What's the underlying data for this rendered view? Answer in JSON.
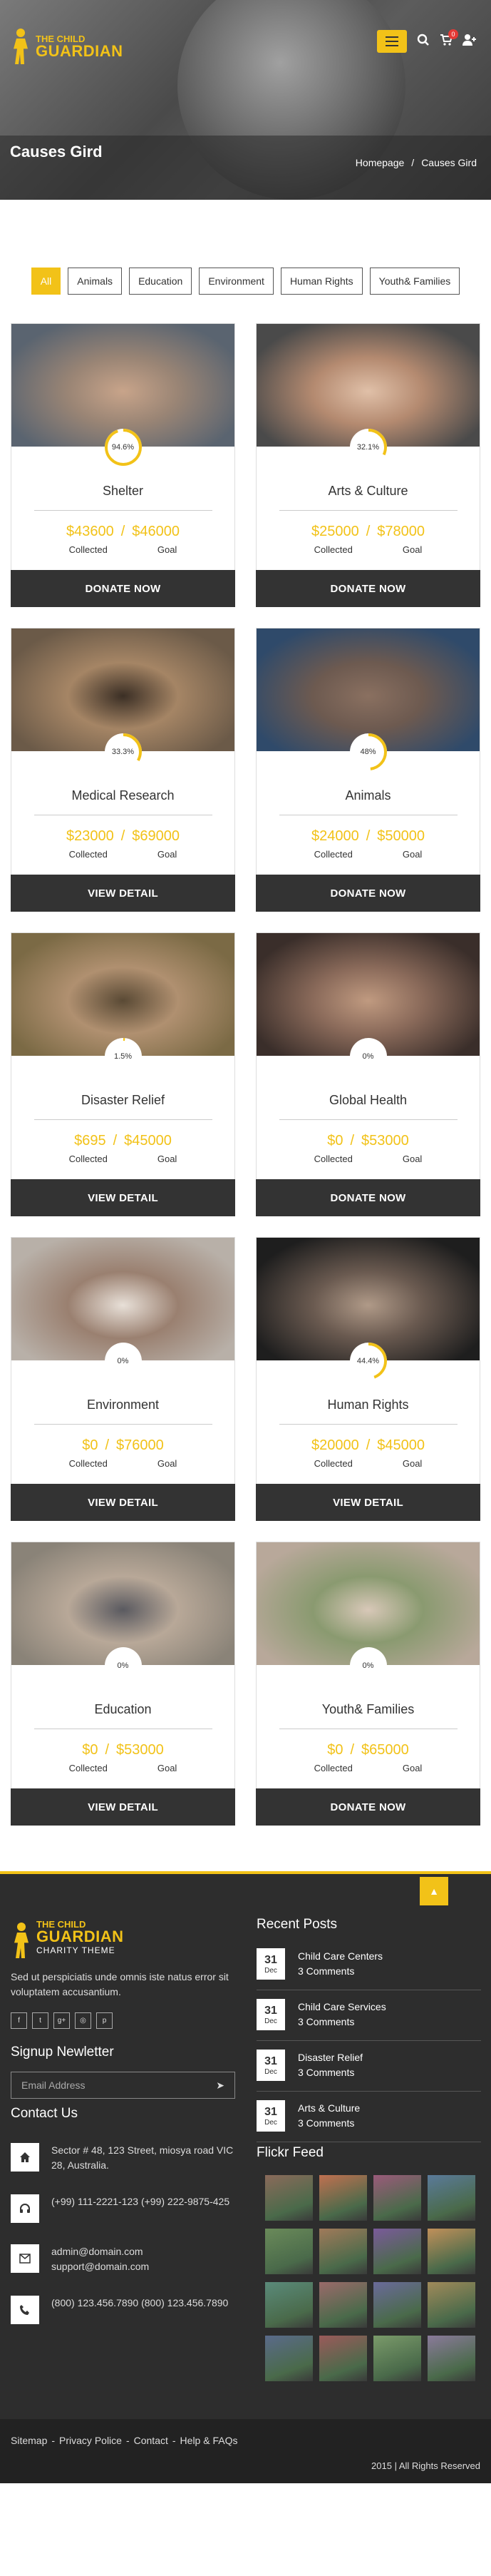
{
  "header": {
    "logo_small": "THE CHILD",
    "logo_big": "GUARDIAN",
    "page_title": "Causes Gird",
    "breadcrumb_home": "Homepage",
    "breadcrumb_sep": "/",
    "breadcrumb_current": "Causes Gird",
    "cart_count": "0"
  },
  "filters": [
    "All",
    "Animals",
    "Education",
    "Environment",
    "Human Rights",
    "Youth& Families"
  ],
  "cards": [
    {
      "title": "Shelter",
      "percent": "94.6%",
      "fraction": 0.946,
      "collected": "$43600",
      "goal": "$46000",
      "button": "DONATE NOW"
    },
    {
      "title": "Arts & Culture",
      "percent": "32.1%",
      "fraction": 0.321,
      "collected": "$25000",
      "goal": "$78000",
      "button": "DONATE NOW"
    },
    {
      "title": "Medical Research",
      "percent": "33.3%",
      "fraction": 0.333,
      "collected": "$23000",
      "goal": "$69000",
      "button": "VIEW DETAIL"
    },
    {
      "title": "Animals",
      "percent": "48%",
      "fraction": 0.48,
      "collected": "$24000",
      "goal": "$50000",
      "button": "DONATE NOW"
    },
    {
      "title": "Disaster Relief",
      "percent": "1.5%",
      "fraction": 0.015,
      "collected": "$695",
      "goal": "$45000",
      "button": "VIEW DETAIL"
    },
    {
      "title": "Global Health",
      "percent": "0%",
      "fraction": 0,
      "collected": "$0",
      "goal": "$53000",
      "button": "DONATE NOW"
    },
    {
      "title": "Environment",
      "percent": "0%",
      "fraction": 0,
      "collected": "$0",
      "goal": "$76000",
      "button": "VIEW DETAIL"
    },
    {
      "title": "Human Rights",
      "percent": "44.4%",
      "fraction": 0.444,
      "collected": "$20000",
      "goal": "$45000",
      "button": "VIEW DETAIL"
    },
    {
      "title": "Education",
      "percent": "0%",
      "fraction": 0,
      "collected": "$0",
      "goal": "$53000",
      "button": "VIEW DETAIL"
    },
    {
      "title": "Youth& Families",
      "percent": "0%",
      "fraction": 0,
      "collected": "$0",
      "goal": "$65000",
      "button": "DONATE NOW"
    }
  ],
  "card_labels": {
    "collected": "Collected",
    "goal": "Goal",
    "slash": "/"
  },
  "footer": {
    "logo_small": "THE CHILD",
    "logo_big": "GUARDIAN",
    "logo_sub": "CHARITY THEME",
    "about": "Sed ut perspiciatis unde omnis iste natus error sit voluptatem accusantium.",
    "newsletter_title": "Signup Newletter",
    "email_placeholder": "Email Address",
    "contact_title": "Contact Us",
    "address": "Sector # 48, 123 Street, miosya road VIC 28, Australia.",
    "phone1": "(+99) 111-2221-123 (+99) 222-9875-425",
    "email1": "admin@domain.com",
    "email2": "support@domain.com",
    "phone2": "(800) 123.456.7890 (800) 123.456.7890",
    "recent_title": "Recent Posts",
    "posts": [
      {
        "day": "31",
        "month": "Dec",
        "title": "Child Care Centers",
        "comments": "3 Comments"
      },
      {
        "day": "31",
        "month": "Dec",
        "title": "Child Care Services",
        "comments": "3 Comments"
      },
      {
        "day": "31",
        "month": "Dec",
        "title": "Disaster Relief",
        "comments": "3 Comments"
      },
      {
        "day": "31",
        "month": "Dec",
        "title": "Arts & Culture",
        "comments": "3 Comments"
      }
    ],
    "flickr_title": "Flickr Feed",
    "bottom_links": [
      "Sitemap",
      "Privacy Police",
      "Contact",
      "Help & FAQs"
    ],
    "link_sep": "-",
    "copyright": "2015 | All Rights Reserved"
  },
  "colors": {
    "accent": "#f2c218",
    "dark": "#333333",
    "footer": "#2d2d2d"
  }
}
